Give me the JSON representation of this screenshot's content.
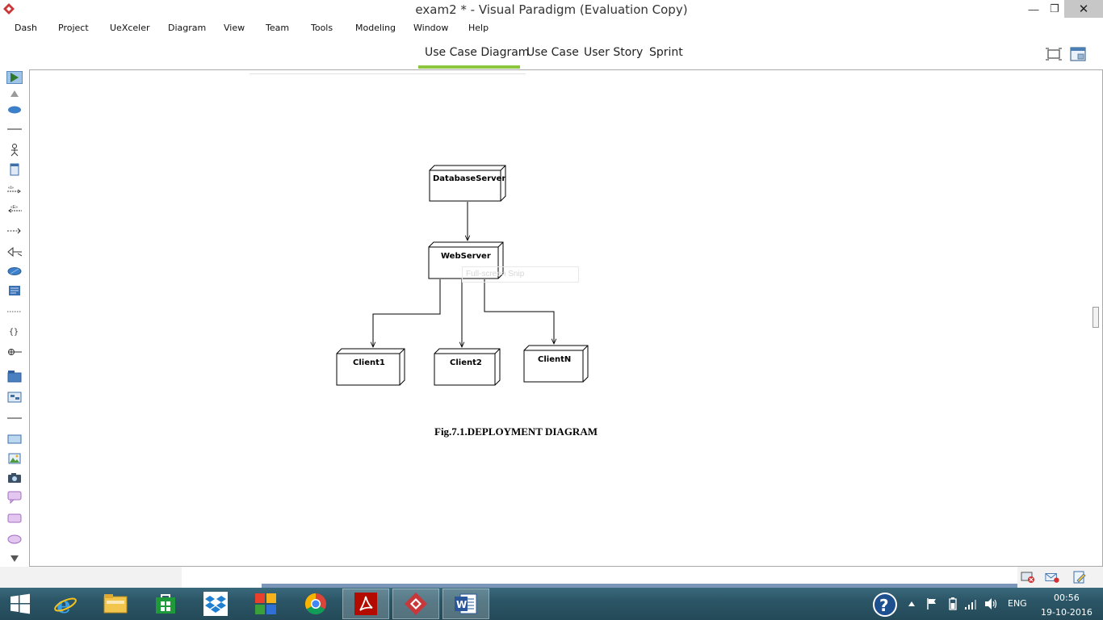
{
  "window": {
    "title": "exam2 * - Visual Paradigm (Evaluation Copy)",
    "minimize_glyph": "—",
    "maximize_glyph": "❐",
    "close_glyph": "✕"
  },
  "menu": {
    "items": [
      "Dash",
      "Project",
      "UeXceler",
      "Diagram",
      "View",
      "Team",
      "Tools",
      "Modeling",
      "Window",
      "Help"
    ]
  },
  "tabs": {
    "items": [
      "Use Case Diagram",
      "Use Case",
      "User Story",
      "Sprint"
    ],
    "active_index": 0
  },
  "diagram": {
    "nodes": {
      "database_server": "DatabaseServer",
      "web_server": "WebServer",
      "client1": "Client1",
      "client2": "Client2",
      "clientn": "ClientN"
    },
    "caption": "Fig.7.1.DEPLOYMENT DIAGRAM",
    "ghost_text": "Full-screen Snip"
  },
  "taskbar": {
    "language": "ENG",
    "time": "00:56",
    "date": "19-10-2016"
  },
  "colors": {
    "tab_accent": "#8cc63f",
    "taskbar": "#2b5566",
    "app_brand": "#c8383a"
  }
}
